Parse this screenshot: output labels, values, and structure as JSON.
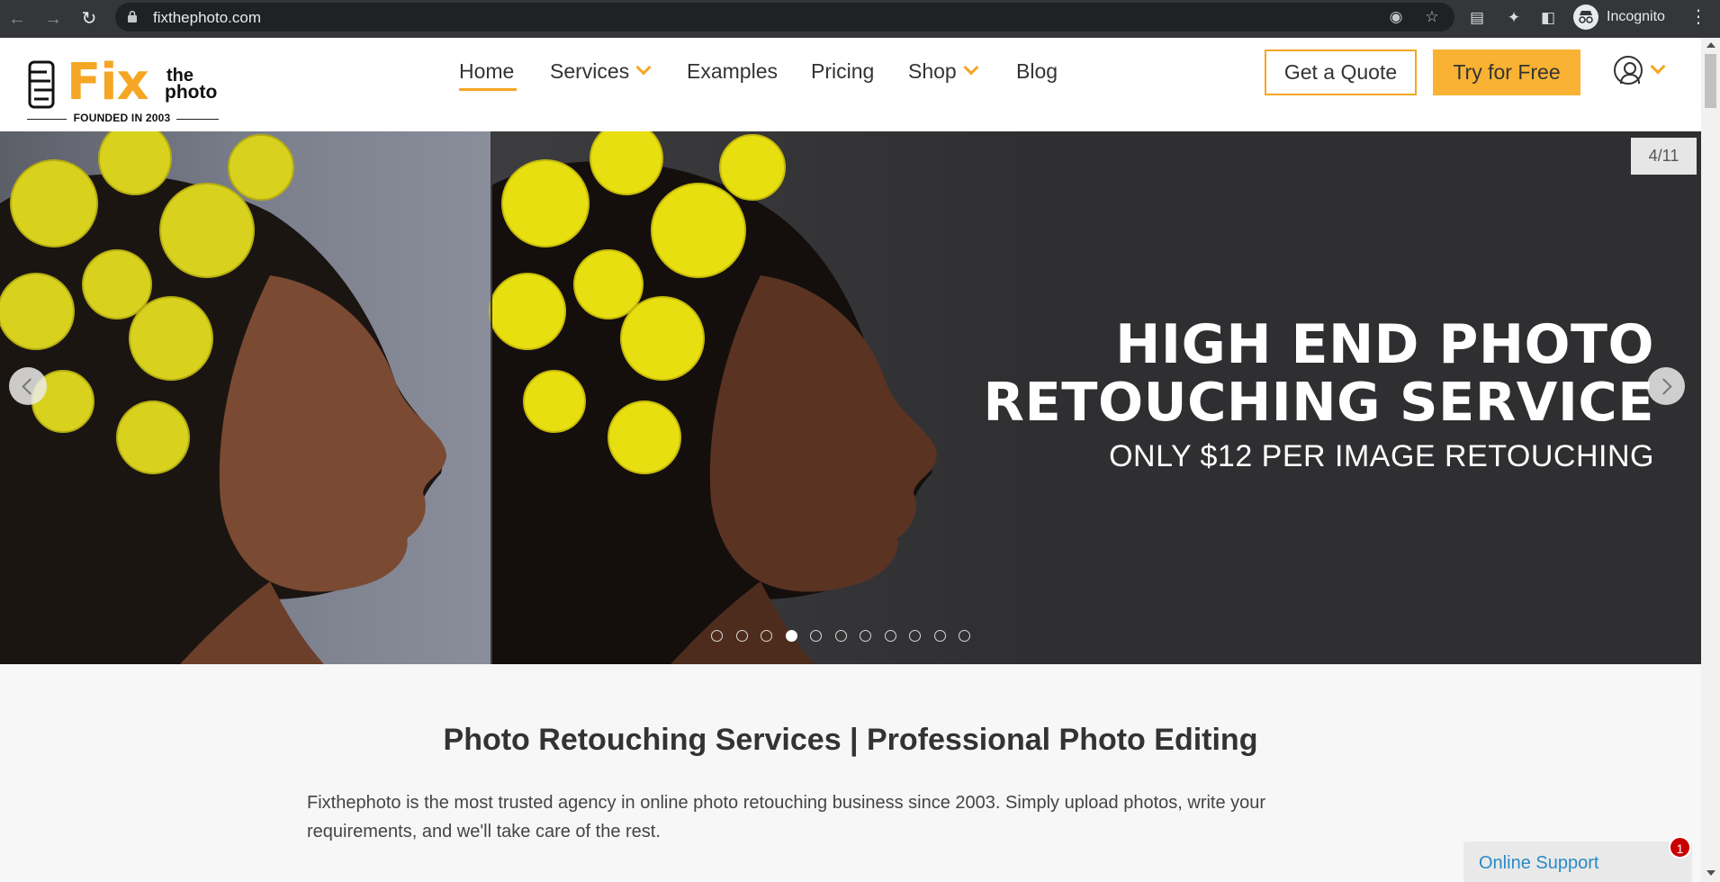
{
  "browser": {
    "url": "fixthephoto.com",
    "profile_label": "Incognito"
  },
  "site": {
    "logo": {
      "word_fix": "Fix",
      "word_the": "the",
      "word_photo": "photo",
      "tagline": "FOUNDED IN 2003"
    },
    "nav": {
      "home": "Home",
      "services": "Services",
      "examples": "Examples",
      "pricing": "Pricing",
      "shop": "Shop",
      "blog": "Blog"
    },
    "buttons": {
      "quote": "Get a Quote",
      "try": "Try for Free"
    }
  },
  "hero": {
    "counter": "4/11",
    "heading_line1": "HIGH END PHOTO",
    "heading_line2": "RETOUCHING SERVICE",
    "subheading": "ONLY $12 PER IMAGE RETOUCHING",
    "slides_total": 11,
    "active_slide": 4
  },
  "content": {
    "title": "Photo Retouching Services | Professional Photo Editing",
    "text": "Fixthephoto is the most trusted agency in online photo retouching business since 2003. Simply upload photos, write your requirements, and we'll take care of the rest."
  },
  "support": {
    "label": "Online Support",
    "badge": "1"
  },
  "colors": {
    "accent": "#f5a623",
    "hero_bg": "#2f2f31",
    "support_text": "#2b8ac6",
    "badge": "#c90000"
  }
}
